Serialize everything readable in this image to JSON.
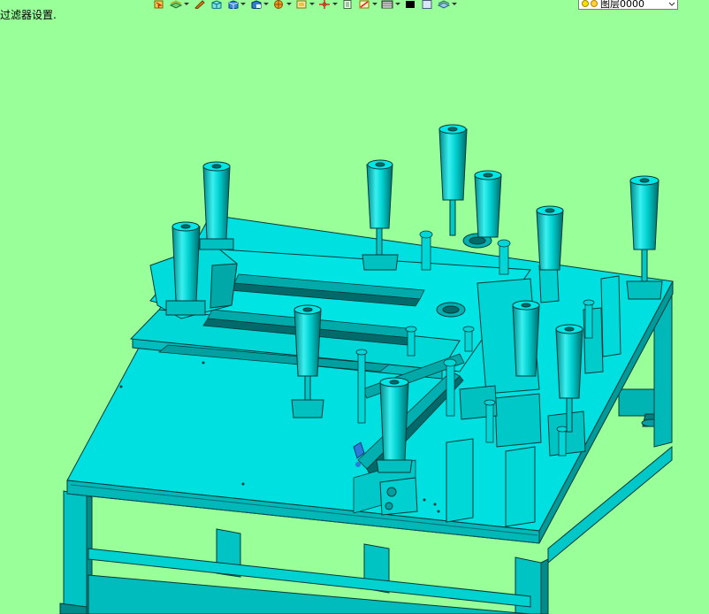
{
  "status_bar": {
    "message": "过滤器设置."
  },
  "toolbar": {
    "buttons": [
      {
        "icon": "select-icon",
        "dropdown": false
      },
      {
        "icon": "layers-stack-icon",
        "dropdown": true
      },
      {
        "icon": "pencil-icon",
        "dropdown": false
      },
      {
        "icon": "shaded-cube-icon",
        "dropdown": false
      },
      {
        "icon": "box-solid-icon",
        "dropdown": true
      },
      {
        "icon": "box-view-icon",
        "dropdown": true
      },
      {
        "icon": "render-sphere-icon",
        "dropdown": true
      },
      {
        "icon": "view-frame-icon",
        "dropdown": true
      },
      {
        "icon": "axis-cross-icon",
        "dropdown": true
      },
      {
        "icon": "page-icon",
        "dropdown": false
      },
      {
        "icon": "line-color-icon",
        "dropdown": true
      },
      {
        "icon": "line-weight-icon",
        "dropdown": true
      },
      {
        "icon": "color-black-icon",
        "dropdown": false
      },
      {
        "icon": "blank-panel-icon",
        "dropdown": false
      },
      {
        "icon": "layer-settings-icon",
        "dropdown": true
      }
    ],
    "layer_selector": {
      "value": "图层0000"
    }
  },
  "colors": {
    "background": "#99ff99",
    "model_fill": "#00e0e0",
    "model_shade": "#00b8b8",
    "model_edge": "#003a3a"
  }
}
